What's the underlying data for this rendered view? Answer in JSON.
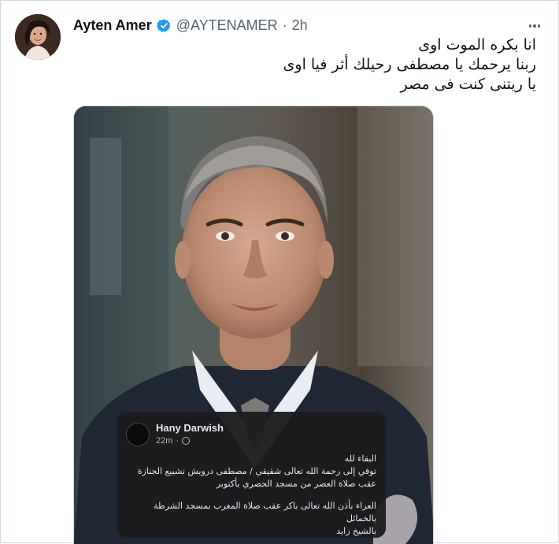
{
  "tweet": {
    "author_name": "Ayten Amer",
    "handle": "@AYTENAMER",
    "separator": "·",
    "time": "2h",
    "lines": [
      "انا بكره الموت اوى",
      "ربنا يرحمك يا مصطفى رحيلك أثر فيا اوى",
      "يا ريتنى كنت فى مصر"
    ]
  },
  "icons": {
    "verified": "verified-badge-icon",
    "more": "more-options-icon",
    "globe": "globe-icon"
  },
  "colors": {
    "verified_blue": "#1d9bf0",
    "muted_text": "#536471"
  },
  "facebook_post": {
    "author": "Hany Darwish",
    "time": "22m",
    "separator": "·",
    "lines": [
      "البقاء لله",
      "توفي إلى رحمة الله تعالى شقيقي / مصطفى درويش تشييع الجنازة",
      "عقب صلاة العصر من مسجد الحصري بأكتوبر",
      "",
      "العزاء بأذن الله تعالى باكر عقب صلاة المغرب بمسجد الشرطة",
      "بالخمائل",
      "بالشيخ زايد"
    ]
  }
}
